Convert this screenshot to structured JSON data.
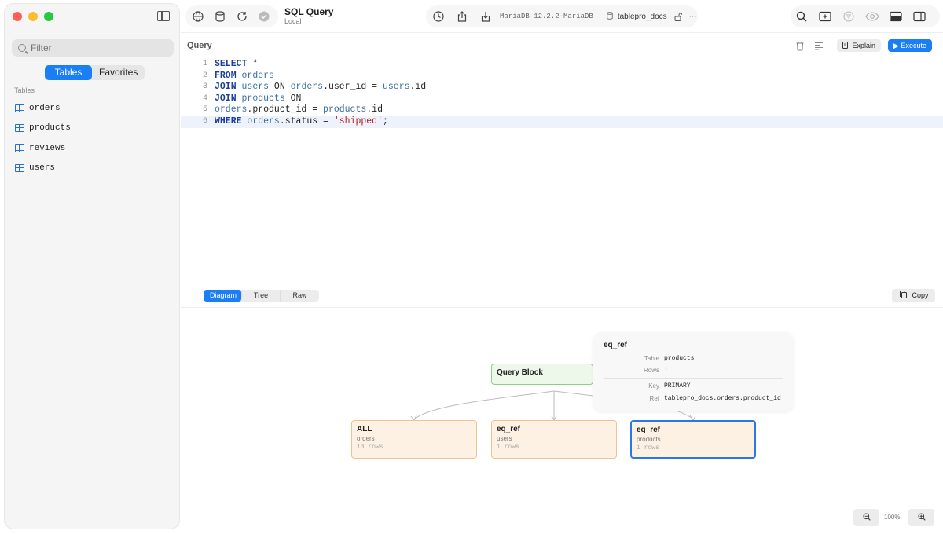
{
  "sidebar": {
    "filter_placeholder": "Filter",
    "tabs": {
      "tables": "Tables",
      "favorites": "Favorites"
    },
    "tables_heading": "Tables",
    "tables": [
      "orders",
      "products",
      "reviews",
      "users"
    ]
  },
  "toolbar": {
    "title": "SQL Query",
    "subtitle": "Local",
    "connection": "MariaDB 12.2.2-MariaDB",
    "database": "tablepro_docs"
  },
  "query": {
    "label": "Query",
    "explain_label": "Explain",
    "execute_label": "Execute",
    "line_numbers": [
      "1",
      "2",
      "3",
      "4",
      "5",
      "6"
    ],
    "current_line": 6
  },
  "results": {
    "tabs": [
      "Diagram",
      "Tree",
      "Raw"
    ],
    "active_tab": "Diagram",
    "copy_label": "Copy"
  },
  "diagram": {
    "root": {
      "title": "Query Block"
    },
    "nodes": [
      {
        "type": "ALL",
        "table": "orders",
        "rows": "10 rows"
      },
      {
        "type": "eq_ref",
        "table": "users",
        "rows": "1 rows"
      },
      {
        "type": "eq_ref",
        "table": "products",
        "rows": "1 rows"
      }
    ],
    "tooltip": {
      "title": "eq_ref",
      "table_label": "Table",
      "table_value": "products",
      "rows_label": "Rows",
      "rows_value": "1",
      "key_label": "Key",
      "key_value": "PRIMARY",
      "ref_label": "Ref",
      "ref_value": "tablepro_docs.orders.product_id"
    },
    "zoom_level": "100%"
  },
  "colors": {
    "accent": "#1a7ef5",
    "root_node": "#eef8ea",
    "leaf_node": "#fdf1e3",
    "selected_border": "#2b78e4"
  }
}
